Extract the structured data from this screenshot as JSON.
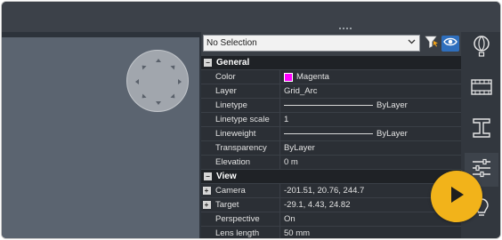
{
  "colors": {
    "accent": "#2f6fbd",
    "magenta": "#ff00ff",
    "play": "#f2b31a",
    "viewport": "#5b6470"
  },
  "selection": {
    "value": "No Selection"
  },
  "toolbar": {
    "filter_icon": "quick-select-funnel-icon",
    "eye_icon": "eye-icon"
  },
  "general": {
    "title": "General",
    "collapse_glyph": "−",
    "rows": [
      {
        "label": "Color",
        "value": "Magenta"
      },
      {
        "label": "Layer",
        "value": "Grid_Arc"
      },
      {
        "label": "Linetype",
        "value": "ByLayer"
      },
      {
        "label": "Linetype scale",
        "value": "1"
      },
      {
        "label": "Lineweight",
        "value": "ByLayer"
      },
      {
        "label": "Transparency",
        "value": "ByLayer"
      },
      {
        "label": "Elevation",
        "value": "0 m"
      }
    ]
  },
  "view": {
    "title": "View",
    "collapse_glyph": "−",
    "expand_glyph": "+",
    "rows": [
      {
        "label": "Camera",
        "value": "-201.51, 20.76, 244.7"
      },
      {
        "label": "Target",
        "value": "-29.1, 4.43, 24.82"
      },
      {
        "label": "Perspective",
        "value": "On"
      },
      {
        "label": "Lens length",
        "value": "50 mm"
      }
    ]
  },
  "right_toolbar": [
    "balloon-icon",
    "film-strip-icon",
    "i-beam-icon",
    "sliders-icon",
    "bulb-icon"
  ],
  "overlay": {
    "icon": "play-icon"
  }
}
